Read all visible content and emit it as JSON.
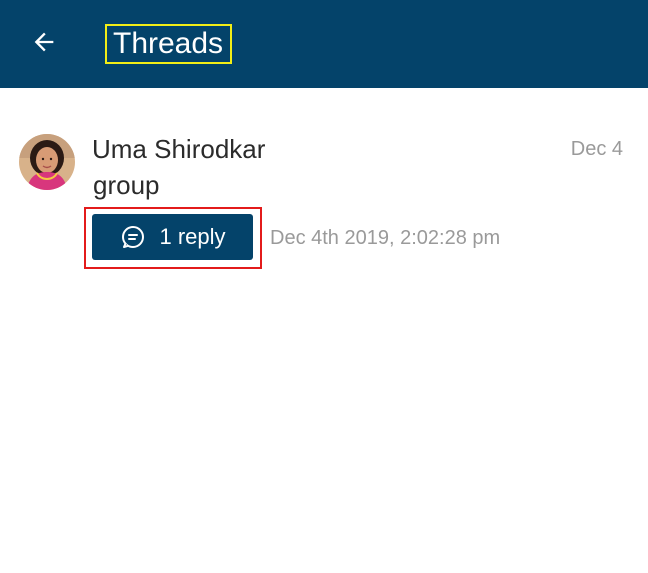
{
  "header": {
    "title": "Threads",
    "back_icon": "arrow-left-icon",
    "background_color": "#04436a",
    "title_highlight_color": "#f2ee16"
  },
  "thread": {
    "author": "Uma Shirodkar",
    "date": "Dec 4",
    "message": "group",
    "reply_button_label": "1 reply",
    "reply_icon": "thread-reply-icon",
    "reply_timestamp": "Dec 4th 2019, 2:02:28 pm",
    "reply_highlight_color": "#e31b1b",
    "button_color": "#04436a"
  }
}
